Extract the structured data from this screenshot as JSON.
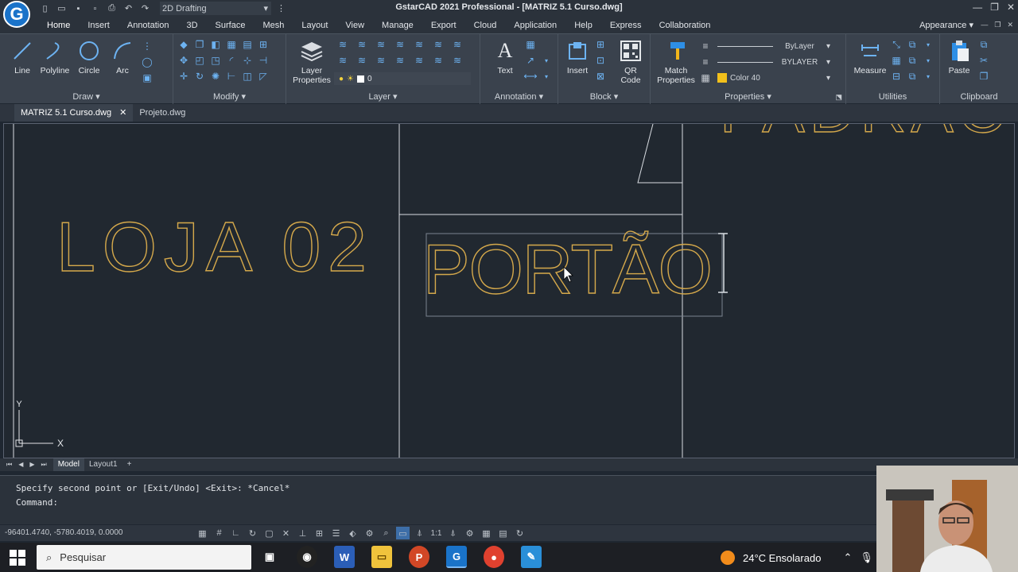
{
  "window": {
    "title": "GstarCAD 2021 Professional - [MATRIZ 5.1 Curso.dwg]",
    "workspace": "2D Drafting"
  },
  "app_logo": "G",
  "ribbon_tabs": [
    "Home",
    "Insert",
    "Annotation",
    "3D",
    "Surface",
    "Mesh",
    "Layout",
    "View",
    "Manage",
    "Export",
    "Cloud",
    "Application",
    "Help",
    "Express",
    "Collaboration"
  ],
  "appearance_label": "Appearance",
  "ribbon": {
    "draw": {
      "title": "Draw",
      "buttons": [
        "Line",
        "Polyline",
        "Circle",
        "Arc"
      ]
    },
    "modify": {
      "title": "Modify"
    },
    "layer": {
      "title": "Layer",
      "properties_label": "Layer Properties",
      "current_layer": "0"
    },
    "annotation": {
      "title": "Annotation",
      "text_label": "Text"
    },
    "block": {
      "title": "Block",
      "insert_label": "Insert",
      "qr_label": "QR Code"
    },
    "properties": {
      "title": "Properties",
      "match_label": "Match Properties",
      "linetype": "ByLayer",
      "lineweight": "BYLAYER",
      "color": "Color 40"
    },
    "utilities": {
      "title": "Utilities",
      "measure_label": "Measure"
    },
    "clipboard": {
      "title": "Clipboard",
      "paste_label": "Paste"
    }
  },
  "doc_tabs": [
    "MATRIZ 5.1 Curso.dwg",
    "Projeto.dwg"
  ],
  "drawing": {
    "text_loja": "LOJA 02",
    "text_portao": "PORTÃO",
    "text_top": "PADRÃO",
    "ucs_y": "Y",
    "ucs_x": "X"
  },
  "layout_tabs": [
    "Model",
    "Layout1",
    "+"
  ],
  "command": {
    "history": "Specify second point or [Exit/Undo] <Exit>: *Cancel*",
    "prompt": "Command:"
  },
  "status": {
    "coordinates": "-96401.4740, -5780.4019, 0.0000",
    "scale": "1:1"
  },
  "taskbar": {
    "search_placeholder": "Pesquisar",
    "weather": "24°C  Ensolarado"
  },
  "colors": {
    "drawing_text": "#d4a84b",
    "canvas_bg": "#212830",
    "ribbon_bg": "#3a424d"
  }
}
